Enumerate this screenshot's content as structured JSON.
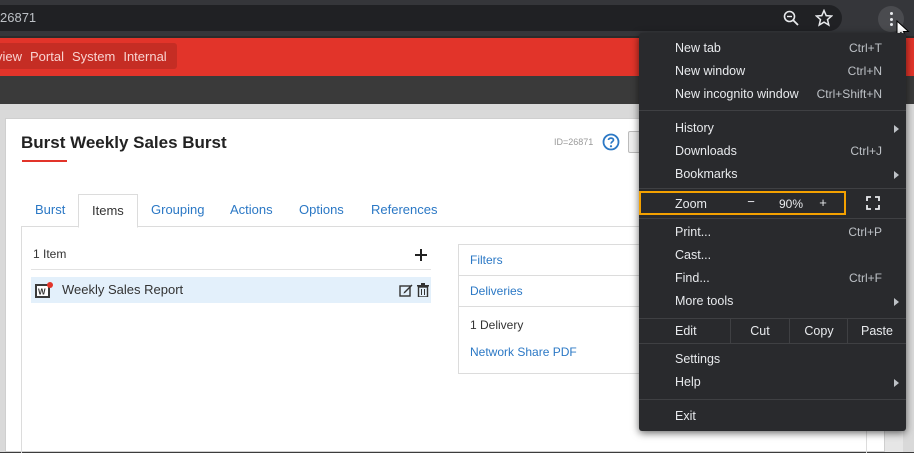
{
  "browser": {
    "url_text": "26871"
  },
  "app_nav": {
    "items": [
      "view",
      "Portal",
      "System",
      "Internal"
    ]
  },
  "page": {
    "title": "Burst Weekly Sales Burst",
    "id_label": "ID=26871",
    "tabs": [
      {
        "label": "Burst",
        "active": false
      },
      {
        "label": "Items",
        "active": true
      },
      {
        "label": "Grouping",
        "active": false
      },
      {
        "label": "Actions",
        "active": false
      },
      {
        "label": "Options",
        "active": false
      },
      {
        "label": "References",
        "active": false
      }
    ],
    "item_count": "1 Item",
    "items": [
      {
        "name": "Weekly Sales Report",
        "icon": "webi-report-icon"
      }
    ],
    "side_panel": {
      "filters": "Filters",
      "deliveries": "Deliveries",
      "delivery_count": "1 Delivery",
      "delivery_item": "Network Share PDF"
    }
  },
  "chrome_menu": {
    "new_tab": {
      "label": "New tab",
      "shortcut": "Ctrl+T"
    },
    "new_window": {
      "label": "New window",
      "shortcut": "Ctrl+N"
    },
    "new_incognito": {
      "label": "New incognito window",
      "shortcut": "Ctrl+Shift+N"
    },
    "history": {
      "label": "History"
    },
    "downloads": {
      "label": "Downloads",
      "shortcut": "Ctrl+J"
    },
    "bookmarks": {
      "label": "Bookmarks"
    },
    "zoom": {
      "label": "Zoom",
      "minus": "−",
      "value": "90%",
      "plus": "+"
    },
    "print": {
      "label": "Print...",
      "shortcut": "Ctrl+P"
    },
    "cast": {
      "label": "Cast..."
    },
    "find": {
      "label": "Find...",
      "shortcut": "Ctrl+F"
    },
    "more_tools": {
      "label": "More tools"
    },
    "edit": {
      "label": "Edit",
      "cut": "Cut",
      "copy": "Copy",
      "paste": "Paste"
    },
    "settings": {
      "label": "Settings"
    },
    "help": {
      "label": "Help"
    },
    "exit": {
      "label": "Exit"
    }
  },
  "colors": {
    "brand_red": "#e2342a",
    "link_blue": "#2b78c5",
    "zoom_highlight": "#f4a100",
    "menu_bg": "#292a2d"
  }
}
